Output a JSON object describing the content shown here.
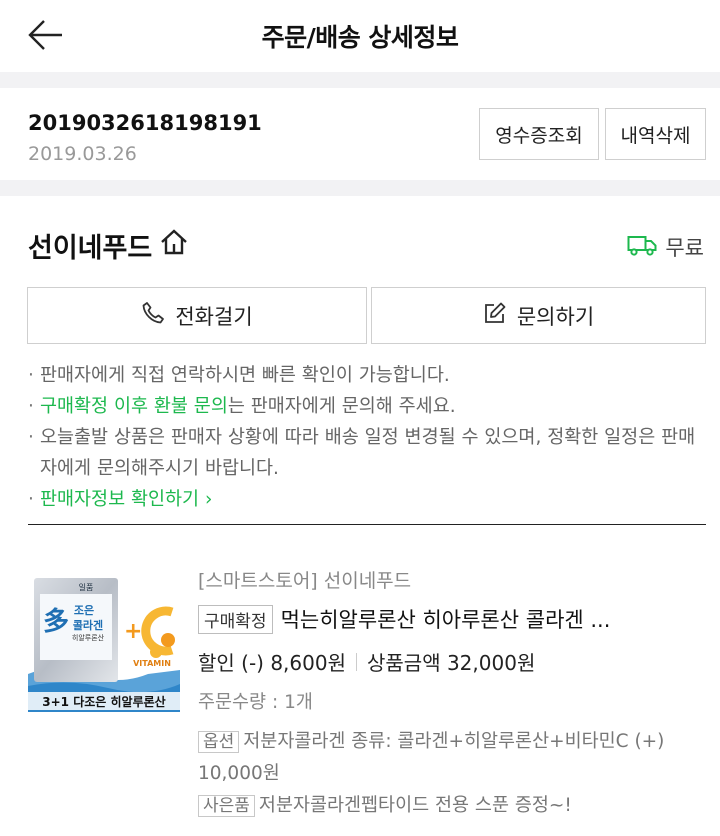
{
  "header": {
    "title": "주문/배송 상세정보",
    "back_icon": "back-arrow-icon"
  },
  "order": {
    "number": "2019032618198191",
    "date": "2019.03.26",
    "receipt_label": "영수증조회",
    "delete_label": "내역삭제"
  },
  "seller": {
    "name": "선이네푸드",
    "home_icon": "home-icon",
    "shipping_icon": "truck-icon",
    "shipping_label": "무료",
    "call_label": "전화걸기",
    "inquiry_label": "문의하기"
  },
  "notes": {
    "note1": "판매자에게 직접 연락하시면 빠른 확인이 가능합니다.",
    "note2_green": "구매확정 이후 환불 문의",
    "note2_rest": "는 판매자에게 문의해 주세요.",
    "note3": "오늘출발 상품은 판매자 상황에 따라 배송 일정 변경될 수 있으며, 정확한 일정은 판매자에게 문의해주시기 바랍니다.",
    "note4_link": "판매자정보 확인하기"
  },
  "product": {
    "shop": "[스마트스토어] 선이네푸드",
    "status_tag": "구매확정",
    "name": "먹는히알루론산 히아루론산 콜라겐 ...",
    "discount": "할인 (-) 8,600원",
    "price": "상품금액 32,000원",
    "quantity": "주문수량 : 1개",
    "option_tag": "옵션",
    "option_text": "저분자콜라겐 종류: 콜라겐+히알루론산+비타민C (+) 10,000원",
    "gift_tag": "사은품",
    "gift_text": "저분자콜라겐펩타이드 전용 스푼 증정~!",
    "image": {
      "brand": "일품",
      "multi_char": "多",
      "line1": "조은",
      "line2": "콜라겐",
      "line3": "히알루론산",
      "vitamin": "VITAMIN",
      "caption": "3+1 다조은 히알루론산"
    }
  },
  "colors": {
    "accent_green": "#1db84e",
    "section_gap": "#f2f2f4"
  }
}
